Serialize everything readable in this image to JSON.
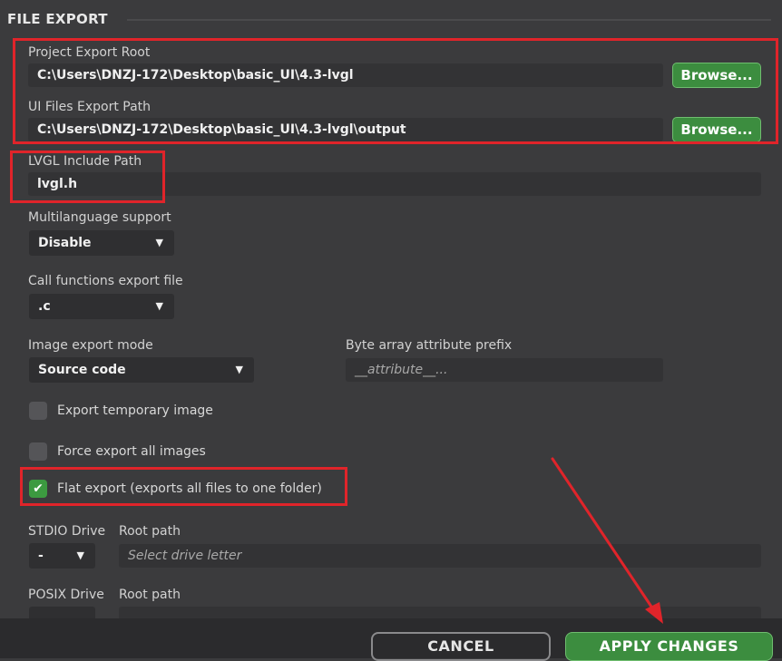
{
  "section": {
    "title": "FILE EXPORT"
  },
  "project_export_root": {
    "label": "Project Export Root",
    "value": "C:\\Users\\DNZJ-172\\Desktop\\basic_UI\\4.3-lvgl",
    "browse_label": "Browse..."
  },
  "ui_files_export_path": {
    "label": "UI Files Export Path",
    "value": "C:\\Users\\DNZJ-172\\Desktop\\basic_UI\\4.3-lvgl\\output",
    "browse_label": "Browse..."
  },
  "lvgl_include_path": {
    "label": "LVGL Include Path",
    "value": "lvgl.h"
  },
  "multilanguage": {
    "label": "Multilanguage support",
    "selected": "Disable"
  },
  "call_functions": {
    "label": "Call functions export file",
    "selected": ".c"
  },
  "image_export_mode": {
    "label": "Image export mode",
    "selected": "Source code"
  },
  "byte_array_prefix": {
    "label": "Byte array attribute prefix",
    "placeholder": "__attribute__..."
  },
  "checkboxes": {
    "export_temp_image": {
      "label": "Export temporary image",
      "checked": false
    },
    "force_export_all": {
      "label": "Force export all images",
      "checked": false
    },
    "flat_export": {
      "label": "Flat export (exports all files to one folder)",
      "checked": true,
      "check_glyph": "✔"
    }
  },
  "stdio": {
    "drive_label": "STDIO Drive",
    "drive_selected": "-",
    "root_label": "Root path",
    "root_placeholder": "Select drive letter"
  },
  "posix": {
    "drive_label": "POSIX Drive",
    "root_label": "Root path"
  },
  "footer": {
    "cancel_label": "CANCEL",
    "apply_label": "APPLY CHANGES"
  },
  "colors": {
    "background": "#3b3b3d",
    "accent_green": "#3c8d3f",
    "annotation_red": "#e0242a"
  },
  "arrow_glyph": "▼"
}
